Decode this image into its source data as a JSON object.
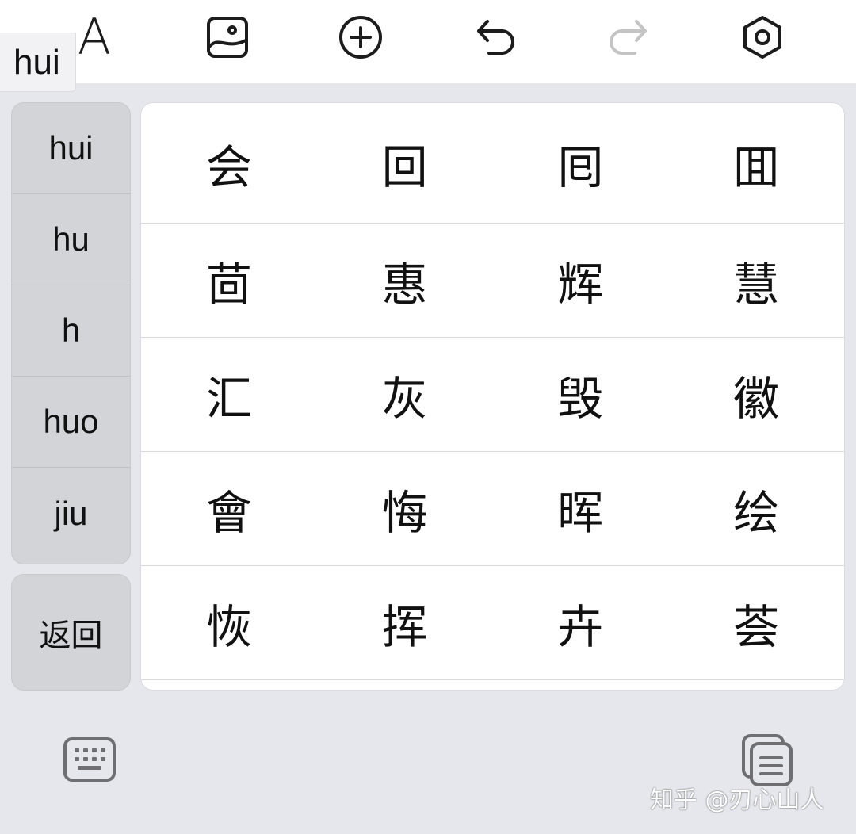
{
  "toolbar": {
    "font_label": "A",
    "icons": [
      "font-icon",
      "image-icon",
      "add-icon",
      "undo-icon",
      "redo-icon",
      "settings-icon"
    ]
  },
  "composition": "hui",
  "pinyin_options": [
    "hui",
    "hu",
    "h",
    "huo",
    "jiu"
  ],
  "back_label": "返回",
  "candidates": [
    [
      "会",
      "回",
      "囘",
      "囬"
    ],
    [
      "茴",
      "惠",
      "辉",
      "慧"
    ],
    [
      "汇",
      "灰",
      "毁",
      "徽"
    ],
    [
      "會",
      "悔",
      "晖",
      "绘"
    ],
    [
      "恢",
      "挥",
      "卉",
      "荟"
    ]
  ],
  "bottom": {
    "left_icon": "keyboard-icon",
    "right_icon": "clipboard-icon"
  },
  "watermark": "知乎 @刃心山人",
  "colors": {
    "background": "#e6e7ec",
    "key": "#d3d4d8",
    "panel": "#ffffff",
    "redo_disabled": "#c4c4c4"
  }
}
